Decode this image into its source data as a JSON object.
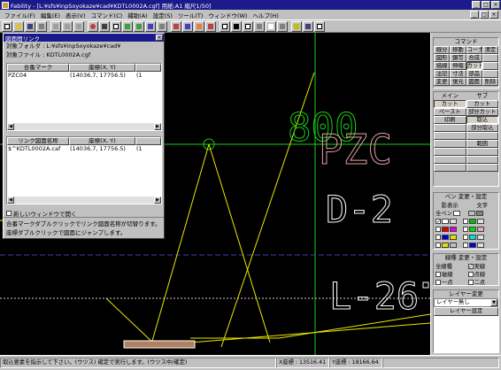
{
  "window": {
    "title": "Fability - [L:¥sfs¥inpSoyokaze¥cad¥KDTL0002A.cgf] 用紙:A1 縮尺1/50]"
  },
  "menu": [
    "ファイル(F)",
    "編集(E)",
    "表示(V)",
    "コマンド(C)",
    "補助(A)",
    "設定(S)",
    "ツール(T)",
    "ウィンドウ(W)",
    "ヘルプ(H)"
  ],
  "dialog": {
    "title": "図面間リンク",
    "folder_label": "対象フォルダ : L:¥sfs¥inpSoyokaze¥cad¥",
    "file_label": "対象ファイル : KDTL0002A.cgf",
    "list1": {
      "headers": [
        "合番マーク",
        "座標(X, Y)"
      ],
      "rows": [
        {
          "name": "PZC04",
          "coord": "(14036.7, 17756.5)",
          "extra": "(1"
        }
      ]
    },
    "list2": {
      "headers": [
        "リンク図面名称",
        "座標(X, Y)"
      ],
      "rows": [
        {
          "name": "$^KDTL0002A.caf",
          "coord": "(14036.7, 17756.5)",
          "extra": "(1"
        }
      ]
    },
    "checkbox_label": "新しいウィンドウで開く",
    "help1": "合番マークダブルクリックでリンク図面名称が切替ります。",
    "help2": "座標ダブルクリックで図面にジャンプします。"
  },
  "panel": {
    "command_title": "コマンド",
    "commands": [
      "線分",
      "移動",
      "コーナー",
      "清定",
      "図形",
      "鏡写",
      "合成",
      "",
      "描線",
      "伸縮",
      "カット",
      "",
      "注記",
      "寸法",
      "部品",
      "",
      "変更",
      "復元",
      "図面",
      "削除"
    ],
    "main_title": "メイン",
    "sub_title": "サブ",
    "main_buttons": [
      "カット",
      "ペースト",
      "印刷"
    ],
    "sub_buttons": [
      "カット",
      "部分カット",
      "取込",
      "部分取込",
      "範囲"
    ],
    "pen_title": "ペン 変更・設定",
    "pen_shadow": "影表示",
    "pen_char": "文字",
    "pen_all": "全ペン",
    "line_title": "線種 変更・設定",
    "line_types": [
      "全線種",
      "実線",
      "破線",
      "点線",
      "一点",
      "二点"
    ],
    "layer_title": "レイヤー変更",
    "layer_value": "レイヤー無し",
    "layer_settings": "レイヤー設定"
  },
  "canvas": {
    "labels": [
      "800",
      "PZC",
      "D-2",
      "L-26"
    ]
  },
  "status": {
    "message": "取込要素を指示して下さい。(ウツス) 確定で実行します。(ウツス中/確定)",
    "x_label": "X座標 : 13516.41",
    "y_label": "Y座標 : 18166.64"
  },
  "colors": {
    "title_bg": "#1a1a8a",
    "canvas_bg": "#000000",
    "cad_green": "#18d018",
    "cad_yellow": "#e8e800",
    "cad_white": "#ffffff"
  }
}
